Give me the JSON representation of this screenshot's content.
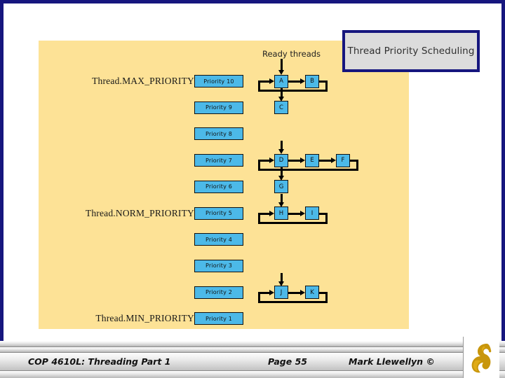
{
  "slide": {
    "title": "Thread Priority Scheduling",
    "ready_label": "Ready threads",
    "panel_color": "#fde296",
    "title_border_color": "#16167e",
    "node_color": "#4cb9e8"
  },
  "priorities": [
    {
      "label": "Priority 10",
      "constant": "Thread.MAX_PRIORITY",
      "threads": [
        "A",
        "B"
      ]
    },
    {
      "label": "Priority 9",
      "constant": "",
      "threads": [
        "C"
      ]
    },
    {
      "label": "Priority 8",
      "constant": "",
      "threads": []
    },
    {
      "label": "Priority 7",
      "constant": "",
      "threads": [
        "D",
        "E",
        "F"
      ]
    },
    {
      "label": "Priority 6",
      "constant": "",
      "threads": [
        "G"
      ]
    },
    {
      "label": "Priority 5",
      "constant": "Thread.NORM_PRIORITY",
      "threads": [
        "H",
        "I"
      ]
    },
    {
      "label": "Priority 4",
      "constant": "",
      "threads": []
    },
    {
      "label": "Priority 3",
      "constant": "",
      "threads": []
    },
    {
      "label": "Priority 2",
      "constant": "",
      "threads": [
        "J",
        "K"
      ]
    },
    {
      "label": "Priority 1",
      "constant": "Thread.MIN_PRIORITY",
      "threads": []
    }
  ],
  "footer": {
    "course": "COP 4610L: Threading Part 1",
    "page": "Page 55",
    "author": "Mark Llewellyn ©",
    "logo_name": "ucf-pegasus-logo"
  }
}
